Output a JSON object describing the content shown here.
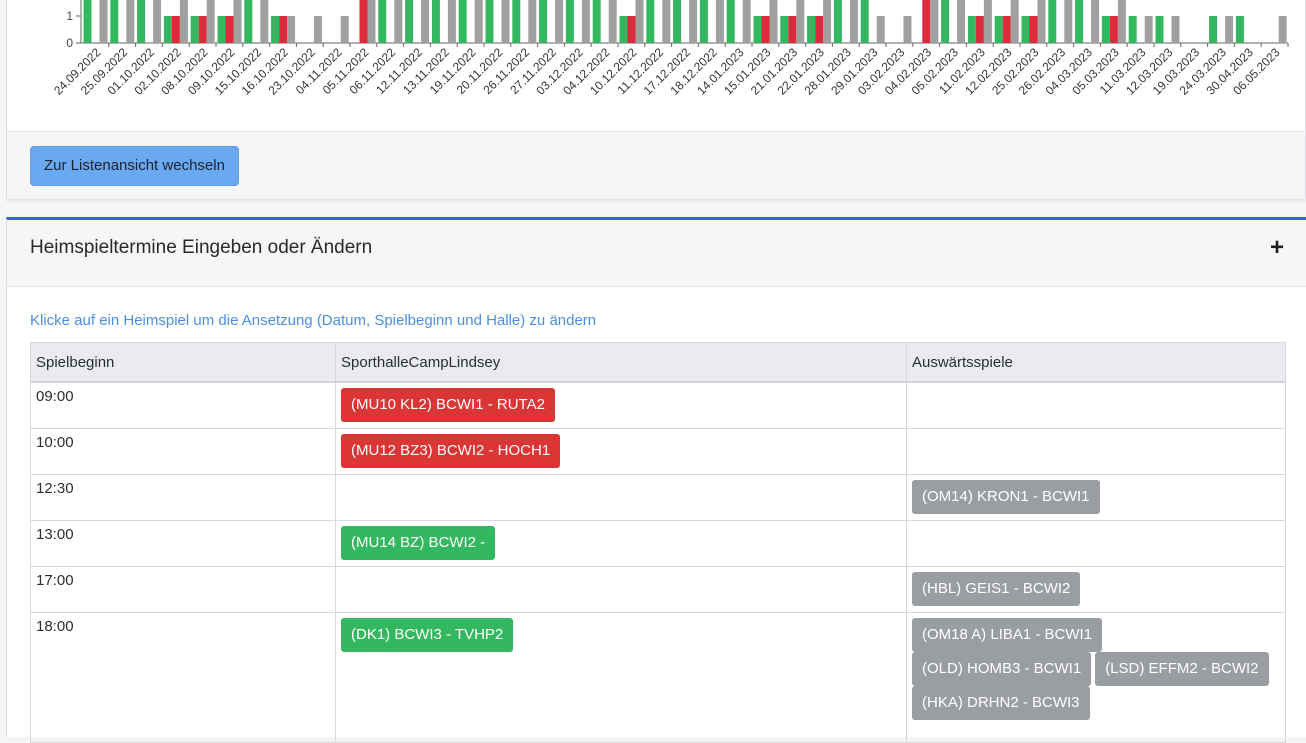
{
  "chart_data": {
    "type": "bar",
    "ylabel": "",
    "y_ticks": [
      "0",
      "1"
    ],
    "colors": {
      "green": "#34b85f",
      "red": "#dc2c3c",
      "grey": "#a0a0a0"
    },
    "categories": [
      "24.09.2022",
      "25.09.2022",
      "01.10.2022",
      "02.10.2022",
      "08.10.2022",
      "09.10.2022",
      "15.10.2022",
      "16.10.2022",
      "23.10.2022",
      "04.11.2022",
      "05.11.2022",
      "06.11.2022",
      "12.11.2022",
      "13.11.2022",
      "19.11.2022",
      "20.11.2022",
      "26.11.2022",
      "27.11.2022",
      "03.12.2022",
      "04.12.2022",
      "10.12.2022",
      "11.12.2022",
      "17.12.2022",
      "18.12.2022",
      "14.01.2023",
      "15.01.2023",
      "21.01.2023",
      "22.01.2023",
      "28.01.2023",
      "29.01.2023",
      "03.02.2023",
      "04.02.2023",
      "05.02.2023",
      "11.02.2023",
      "12.02.2023",
      "25.02.2023",
      "26.02.2023",
      "04.03.2023",
      "05.03.2023",
      "11.03.2023",
      "12.03.2023",
      "19.03.2023",
      "24.03.2023",
      "30.04.2023",
      "06.05.2023"
    ],
    "series": [
      {
        "values": [
          2,
          2,
          2,
          1,
          1,
          1,
          2,
          1,
          0,
          0,
          0,
          2,
          2,
          2,
          2,
          2,
          2,
          2,
          2,
          2,
          1,
          2,
          2,
          2,
          2,
          1,
          1,
          1,
          2,
          2,
          0,
          0,
          2,
          1,
          1,
          1,
          2,
          2,
          1,
          1,
          1,
          0,
          1,
          1,
          0
        ]
      },
      {
        "values": [
          0,
          0,
          0,
          1,
          1,
          1,
          0,
          1,
          0,
          0,
          2,
          0,
          0,
          0,
          0,
          0,
          0,
          0,
          0,
          0,
          1,
          0,
          0,
          0,
          0,
          1,
          1,
          1,
          0,
          0,
          0,
          2,
          0,
          1,
          1,
          1,
          0,
          0,
          1,
          0,
          0,
          0,
          0,
          0,
          0
        ]
      },
      {
        "values": [
          2,
          2,
          2,
          2,
          2,
          2,
          2,
          1,
          1,
          1,
          2,
          2,
          2,
          2,
          2,
          2,
          2,
          2,
          2,
          2,
          2,
          2,
          2,
          2,
          2,
          2,
          2,
          2,
          2,
          1,
          1,
          2,
          2,
          2,
          2,
          2,
          2,
          2,
          2,
          1,
          1,
          0,
          1,
          0,
          1
        ]
      }
    ]
  },
  "button_list_view": "Zur Listenansicht wechseln",
  "section": {
    "title": "Heimspieltermine Eingeben oder Ändern",
    "toggle": "+",
    "hint": "Klicke auf ein Heimspiel um die Ansetzung (Datum, Spielbeginn und Halle) zu ändern",
    "columns": [
      "Spielbeginn",
      "SporthalleCampLindsey",
      "Auswärtsspiele"
    ],
    "rows": [
      {
        "time": "09:00",
        "home": [
          {
            "label": "(MU10 KL2) BCWI1 - RUTA2",
            "color": "red"
          }
        ],
        "away": []
      },
      {
        "time": "10:00",
        "home": [
          {
            "label": "(MU12 BZ3) BCWI2 - HOCH1",
            "color": "red"
          }
        ],
        "away": []
      },
      {
        "time": "12:30",
        "home": [],
        "away": [
          {
            "label": "(OM14) KRON1 - BCWI1",
            "color": "grey"
          }
        ]
      },
      {
        "time": "13:00",
        "home": [
          {
            "label": "(MU14 BZ) BCWI2 -",
            "color": "green"
          }
        ],
        "away": []
      },
      {
        "time": "17:00",
        "home": [],
        "away": [
          {
            "label": "(HBL) GEIS1 - BCWI2",
            "color": "grey"
          }
        ]
      },
      {
        "time": "18:00",
        "home": [
          {
            "label": "(DK1) BCWI3 - TVHP2",
            "color": "green"
          }
        ],
        "away": [
          {
            "label": "(OM18 A) LIBA1 - BCWI1",
            "color": "grey"
          },
          {
            "label": "(OLD) HOMB3 - BCWI1",
            "color": "grey"
          },
          {
            "label": "(LSD) EFFM2 - BCWI2",
            "color": "grey"
          },
          {
            "label": "(HKA) DRHN2 - BCWI3",
            "color": "grey"
          }
        ]
      }
    ]
  }
}
